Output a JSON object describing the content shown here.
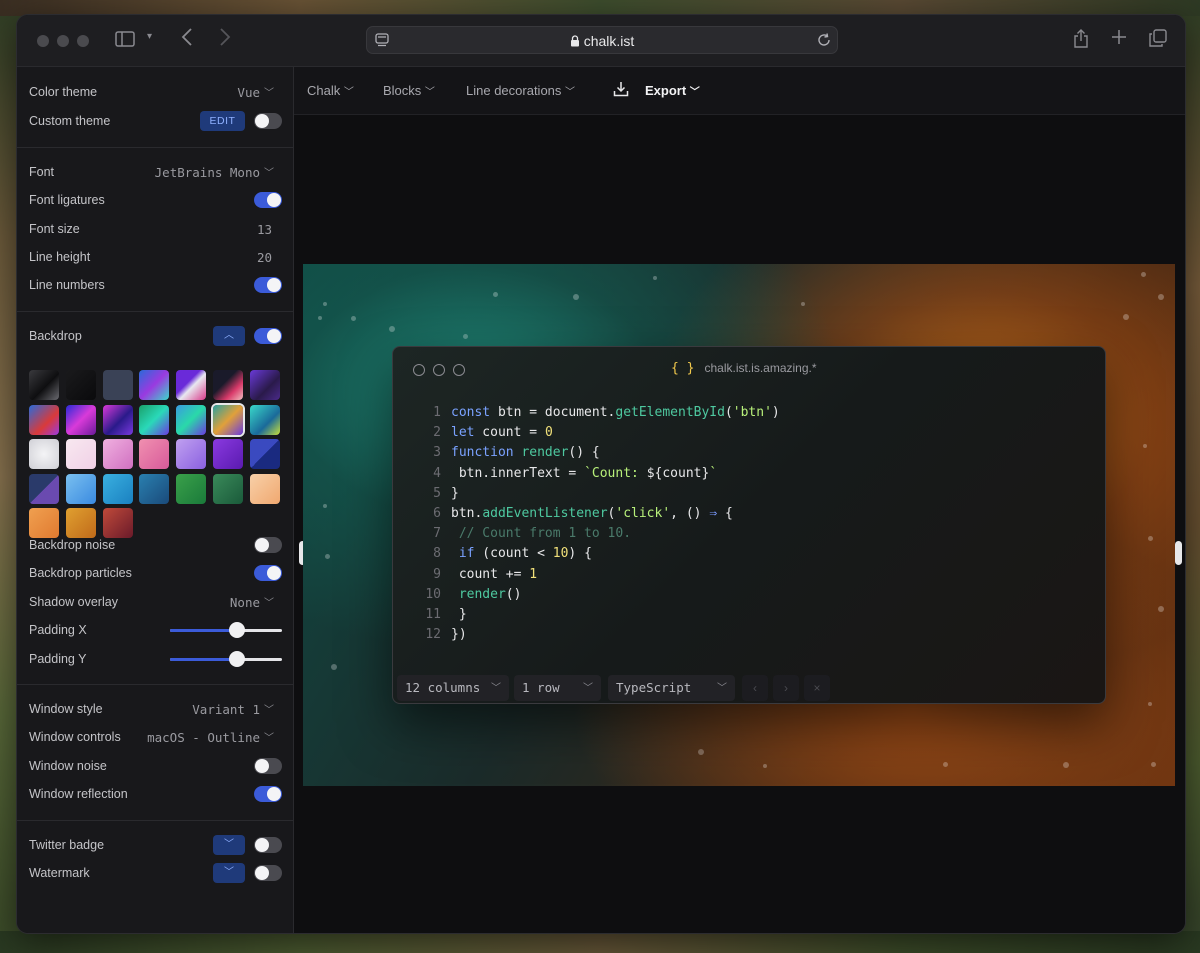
{
  "browser": {
    "url": "chalk.ist"
  },
  "sidebar": {
    "color_theme": {
      "label": "Color theme",
      "value": "Vue"
    },
    "custom_theme": {
      "label": "Custom theme",
      "edit_label": "EDIT",
      "on": false
    },
    "font": {
      "label": "Font",
      "value": "JetBrains Mono"
    },
    "font_ligatures": {
      "label": "Font ligatures",
      "on": true
    },
    "font_size": {
      "label": "Font size",
      "value": "13"
    },
    "line_height": {
      "label": "Line height",
      "value": "20"
    },
    "line_numbers": {
      "label": "Line numbers",
      "on": true
    },
    "backdrop": {
      "label": "Backdrop",
      "on": true
    },
    "backdrop_noise": {
      "label": "Backdrop noise",
      "on": false
    },
    "backdrop_particles": {
      "label": "Backdrop particles",
      "on": true
    },
    "shadow_overlay": {
      "label": "Shadow overlay",
      "value": "None"
    },
    "padding_x": {
      "label": "Padding X",
      "level": 0.6
    },
    "padding_y": {
      "label": "Padding Y",
      "level": 0.6
    },
    "window_style": {
      "label": "Window style",
      "value": "Variant 1"
    },
    "window_controls": {
      "label": "Window controls",
      "value": "macOS - Outline"
    },
    "window_noise": {
      "label": "Window noise",
      "on": false
    },
    "window_reflection": {
      "label": "Window reflection",
      "on": true
    },
    "twitter_badge": {
      "label": "Twitter badge",
      "on": false
    },
    "watermark": {
      "label": "Watermark",
      "on": false
    }
  },
  "menu": {
    "chalk": "Chalk",
    "blocks": "Blocks",
    "line_decorations": "Line decorations",
    "export": "Export"
  },
  "editor": {
    "title": "chalk.ist.is.amazing.*",
    "braces": "{ }",
    "columns": "12 columns",
    "rows": "1 row",
    "language": "TypeScript",
    "line_numbers": [
      "1",
      "2",
      "3",
      "4",
      "5",
      "6",
      "7",
      "8",
      "9",
      "10",
      "11",
      "12"
    ]
  }
}
